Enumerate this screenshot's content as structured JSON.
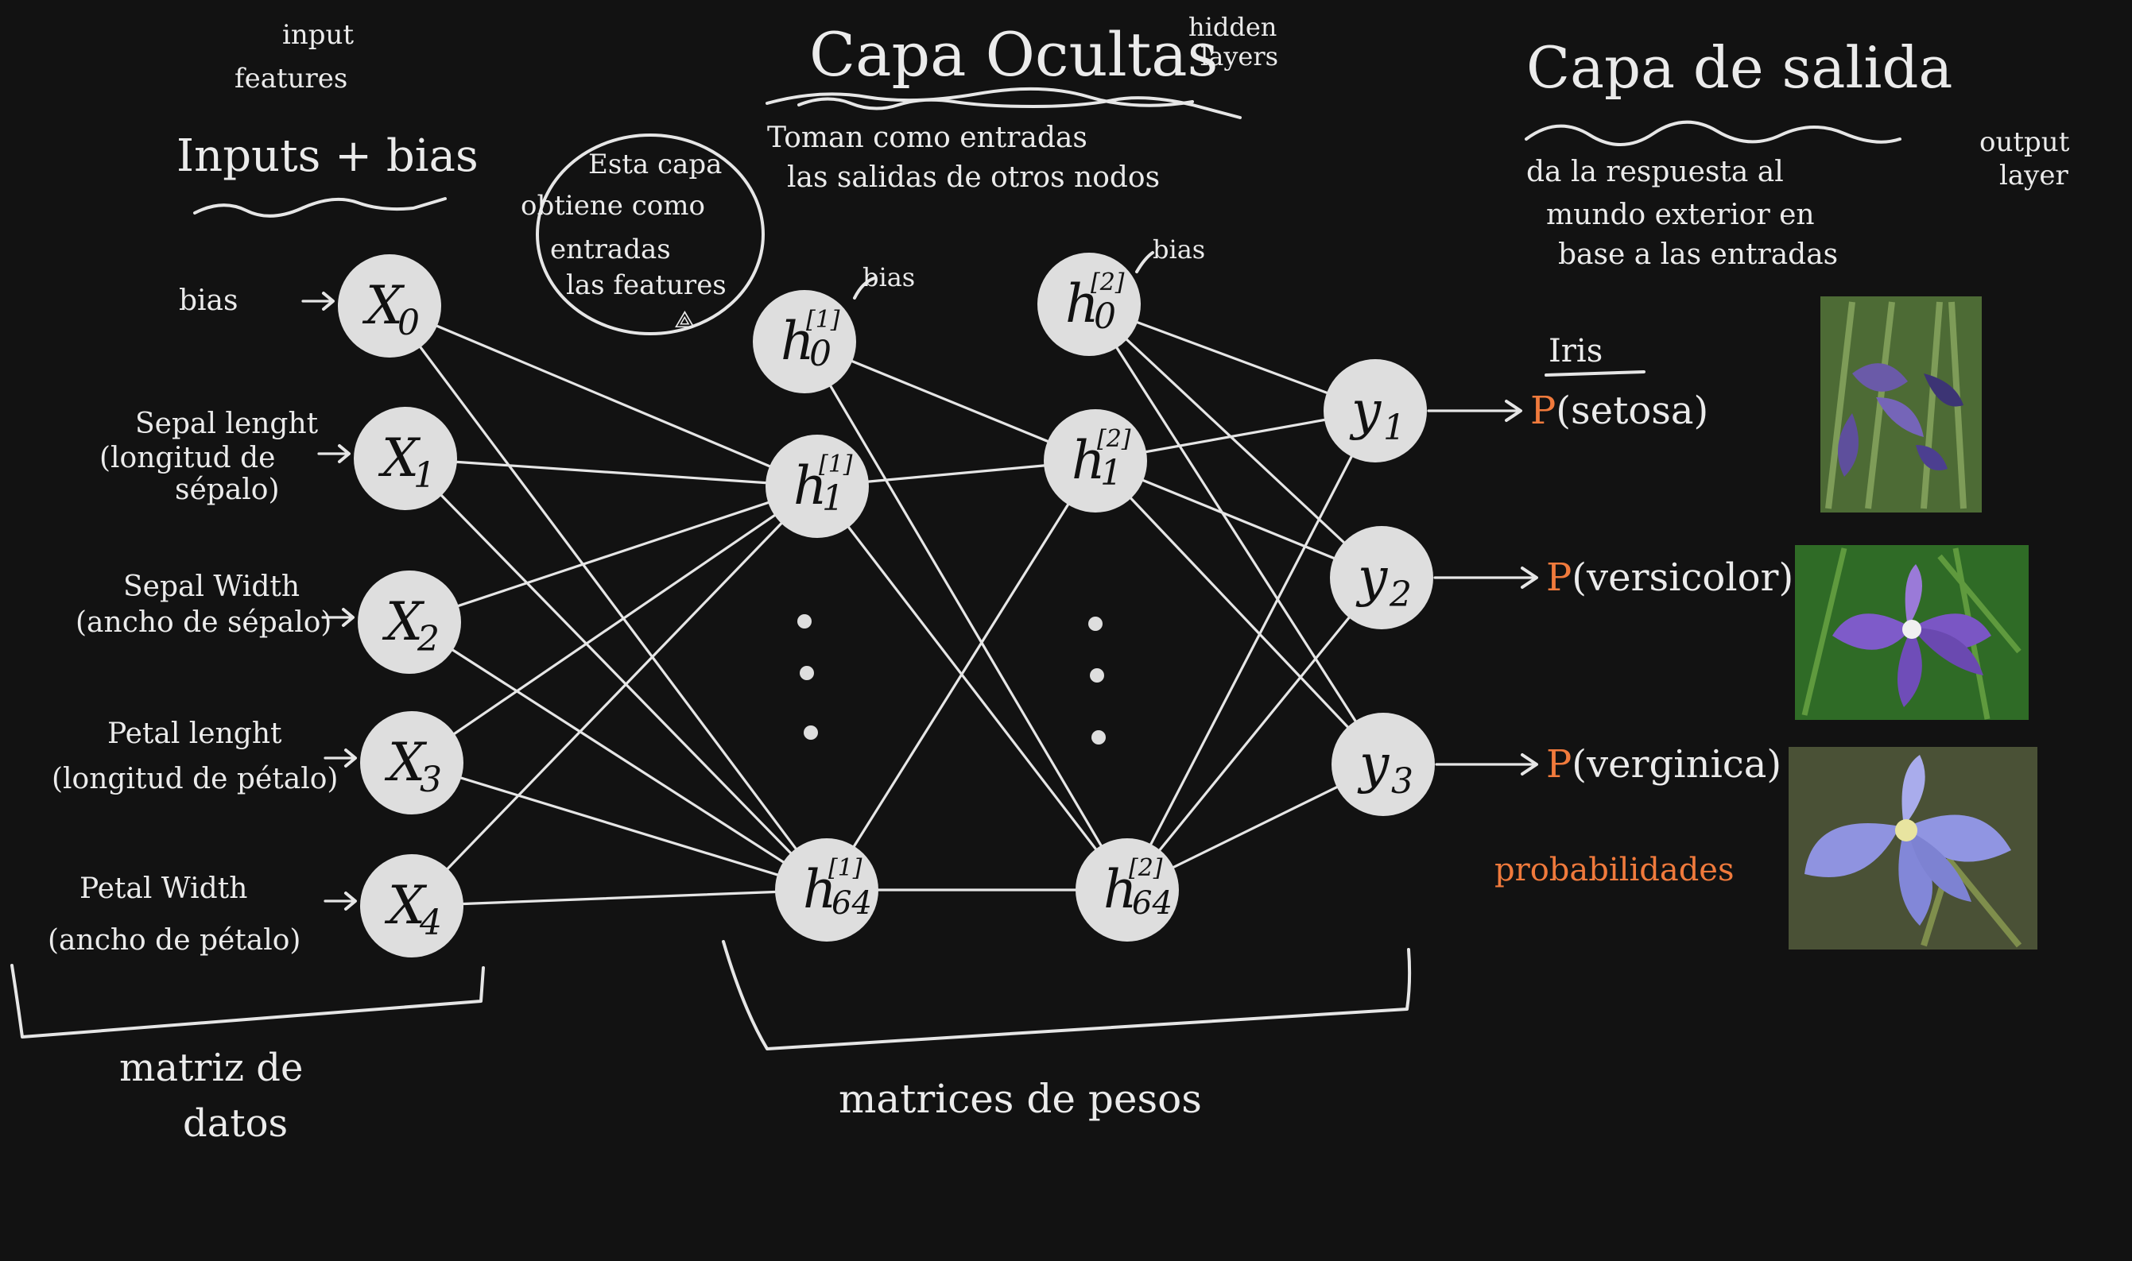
{
  "annotations": {
    "input_features_note": [
      "input",
      "features"
    ],
    "inputs_title": "Inputs + bias",
    "input_layer_callout": [
      "Esta capa",
      "obtiene como",
      "entradas",
      "las features"
    ],
    "hidden_title": "Capa Ocultas",
    "hidden_layers_note": [
      "hidden",
      "layers"
    ],
    "hidden_desc": [
      "Toman como entradas",
      "las salidas de otros nodos"
    ],
    "output_title": "Capa de salida",
    "output_layer_note": [
      "output",
      "layer"
    ],
    "output_desc": [
      "da la respuesta al",
      "mundo exterior en",
      "base a las entradas"
    ],
    "bias_h1": "bias",
    "bias_h2": "bias",
    "iris_label": "Iris",
    "probabilities": "probabilidades",
    "data_matrix": [
      "matriz de",
      "datos"
    ],
    "weights_matrix": "matrices de pesos"
  },
  "inputs": [
    {
      "node": "X",
      "sub": "0",
      "label": [
        "bias"
      ]
    },
    {
      "node": "X",
      "sub": "1",
      "label": [
        "Sepal lenght",
        "(longitud de",
        "sépalo)"
      ]
    },
    {
      "node": "X",
      "sub": "2",
      "label": [
        "Sepal Width",
        "(ancho de sépalo)"
      ]
    },
    {
      "node": "X",
      "sub": "3",
      "label": [
        "Petal lenght",
        "(longitud de pétalo)"
      ]
    },
    {
      "node": "X",
      "sub": "4",
      "label": [
        "Petal Width",
        "(ancho de pétalo)"
      ]
    }
  ],
  "hidden1": [
    {
      "node": "h",
      "sup": "[1]",
      "sub": "0"
    },
    {
      "node": "h",
      "sup": "[1]",
      "sub": "1"
    },
    {
      "node": "h",
      "sup": "[1]",
      "sub": "64"
    }
  ],
  "hidden2": [
    {
      "node": "h",
      "sup": "[2]",
      "sub": "0"
    },
    {
      "node": "h",
      "sup": "[2]",
      "sub": "1"
    },
    {
      "node": "h",
      "sup": "[2]",
      "sub": "64"
    }
  ],
  "outputs": [
    {
      "node": "y",
      "sub": "1",
      "prob": "P(setosa)"
    },
    {
      "node": "y",
      "sub": "2",
      "prob": "P(versicolor)"
    },
    {
      "node": "y",
      "sub": "3",
      "prob": "P(verginica)"
    }
  ],
  "colors": {
    "background": "#121212",
    "chalk": "#e6e6e6",
    "node": "#dedede",
    "accent": "#f07a3c"
  }
}
